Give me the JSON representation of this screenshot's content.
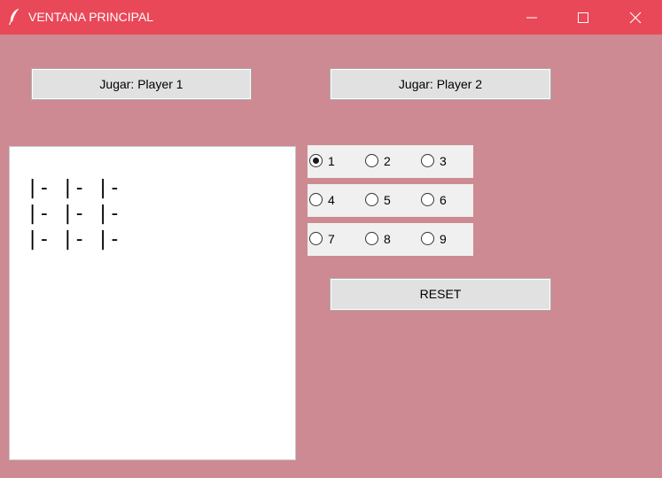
{
  "window": {
    "title": "VENTANA PRINCIPAL",
    "titlebar_color": "#e94858",
    "background_color": "#cd8a92",
    "icons": {
      "app": "feather-icon",
      "minimize": "minimize-icon",
      "maximize": "maximize-icon",
      "close": "close-icon"
    }
  },
  "buttons": {
    "player1": "Jugar: Player 1",
    "player2": "Jugar: Player 2",
    "reset": "RESET"
  },
  "board": {
    "lines": [
      "|- |- |-",
      "|- |- |-",
      "|- |- |-"
    ]
  },
  "positions": {
    "options": [
      "1",
      "2",
      "3",
      "4",
      "5",
      "6",
      "7",
      "8",
      "9"
    ],
    "selected": "1"
  }
}
